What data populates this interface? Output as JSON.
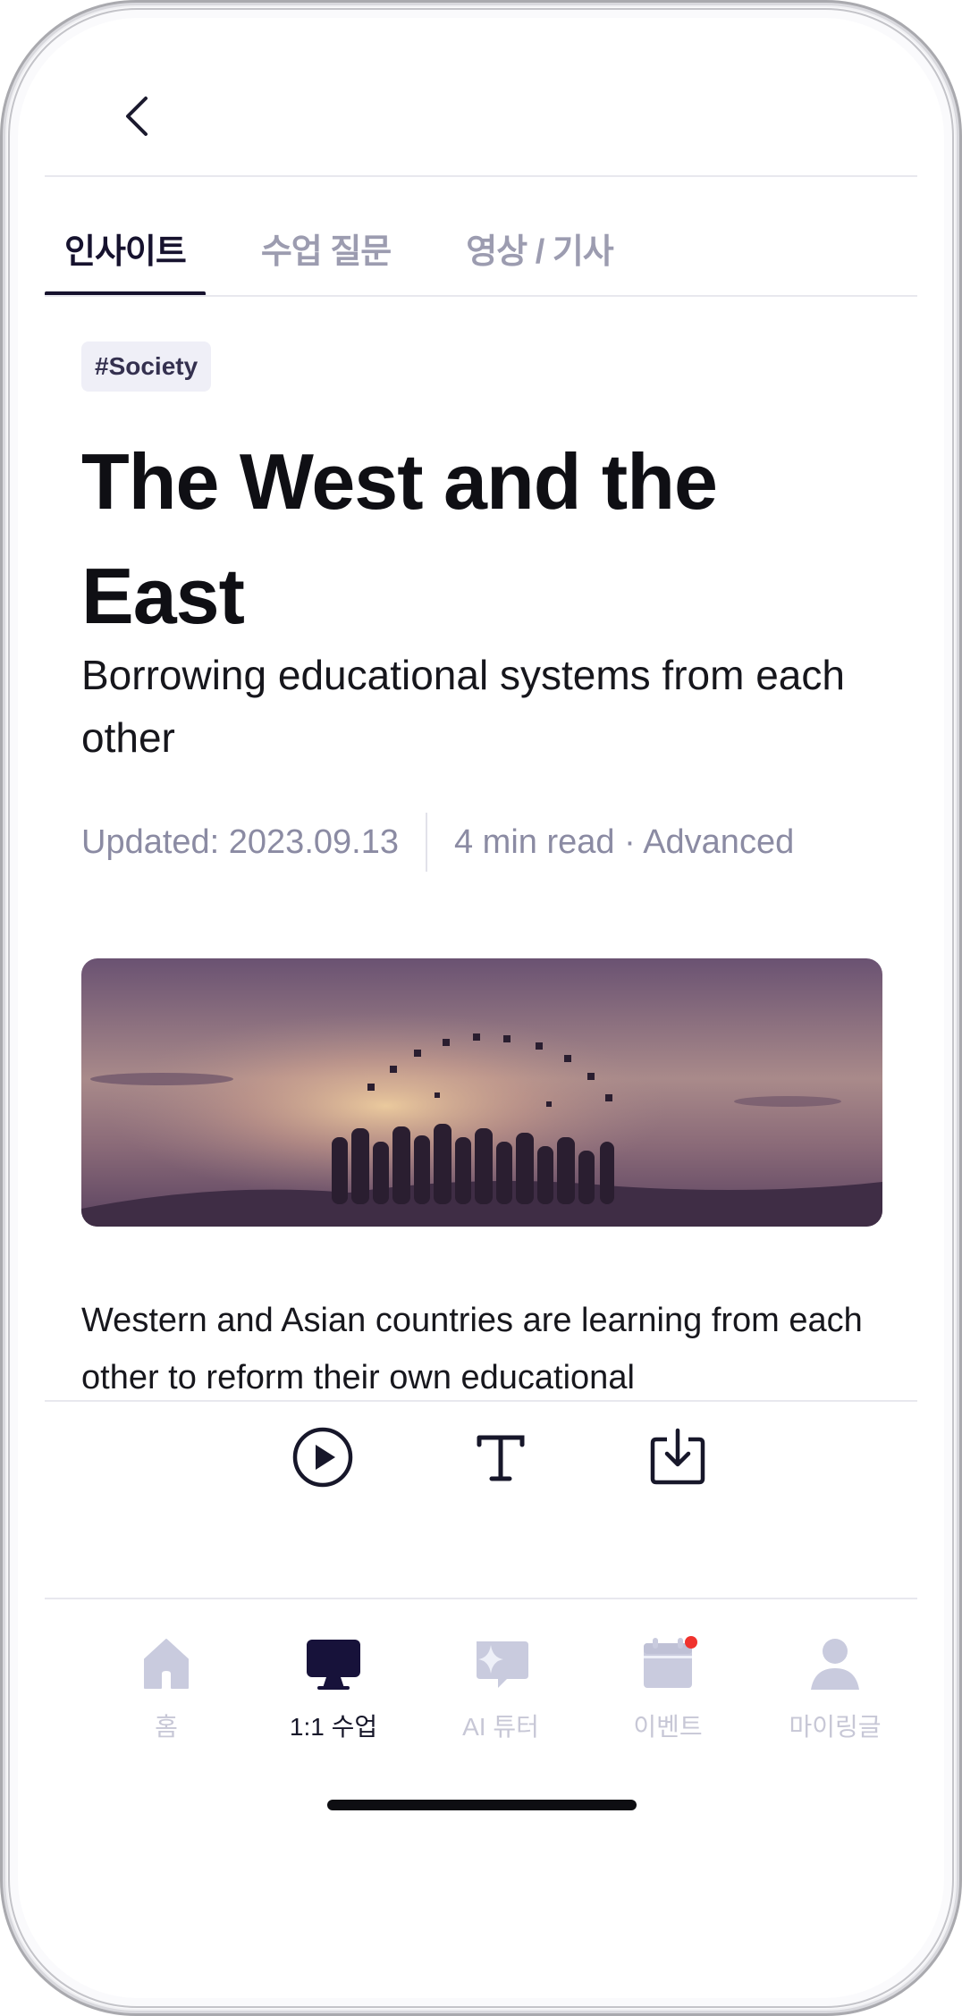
{
  "header": {
    "back_icon": "chevron-left-icon"
  },
  "tabs": [
    {
      "label": "인사이트",
      "active": true
    },
    {
      "label": "수업 질문",
      "active": false
    },
    {
      "label": "영상 / 기사",
      "active": false
    }
  ],
  "article": {
    "tag": "#Society",
    "title": "The West and the East",
    "subtitle": "Borrowing educational systems from each other",
    "updated": "Updated: 2023.09.13",
    "read_info": "4 min read · Advanced",
    "body": "Western and Asian countries are learning from each other to reform their own educational"
  },
  "toolbar": {
    "play_icon": "play-circle-icon",
    "text_icon": "text-size-icon",
    "download_icon": "download-icon"
  },
  "nav": {
    "items": [
      {
        "label": "홈",
        "icon": "home-icon",
        "active": false
      },
      {
        "label": "1:1 수업",
        "icon": "monitor-icon",
        "active": true
      },
      {
        "label": "AI 튜터",
        "icon": "ai-chat-icon",
        "active": false
      },
      {
        "label": "이벤트",
        "icon": "calendar-icon",
        "active": false,
        "badge": true
      },
      {
        "label": "마이링글",
        "icon": "profile-icon",
        "active": false
      }
    ]
  },
  "colors": {
    "accent": "#16122e",
    "inactive": "#c7c7d6",
    "badge": "#f0322d"
  }
}
